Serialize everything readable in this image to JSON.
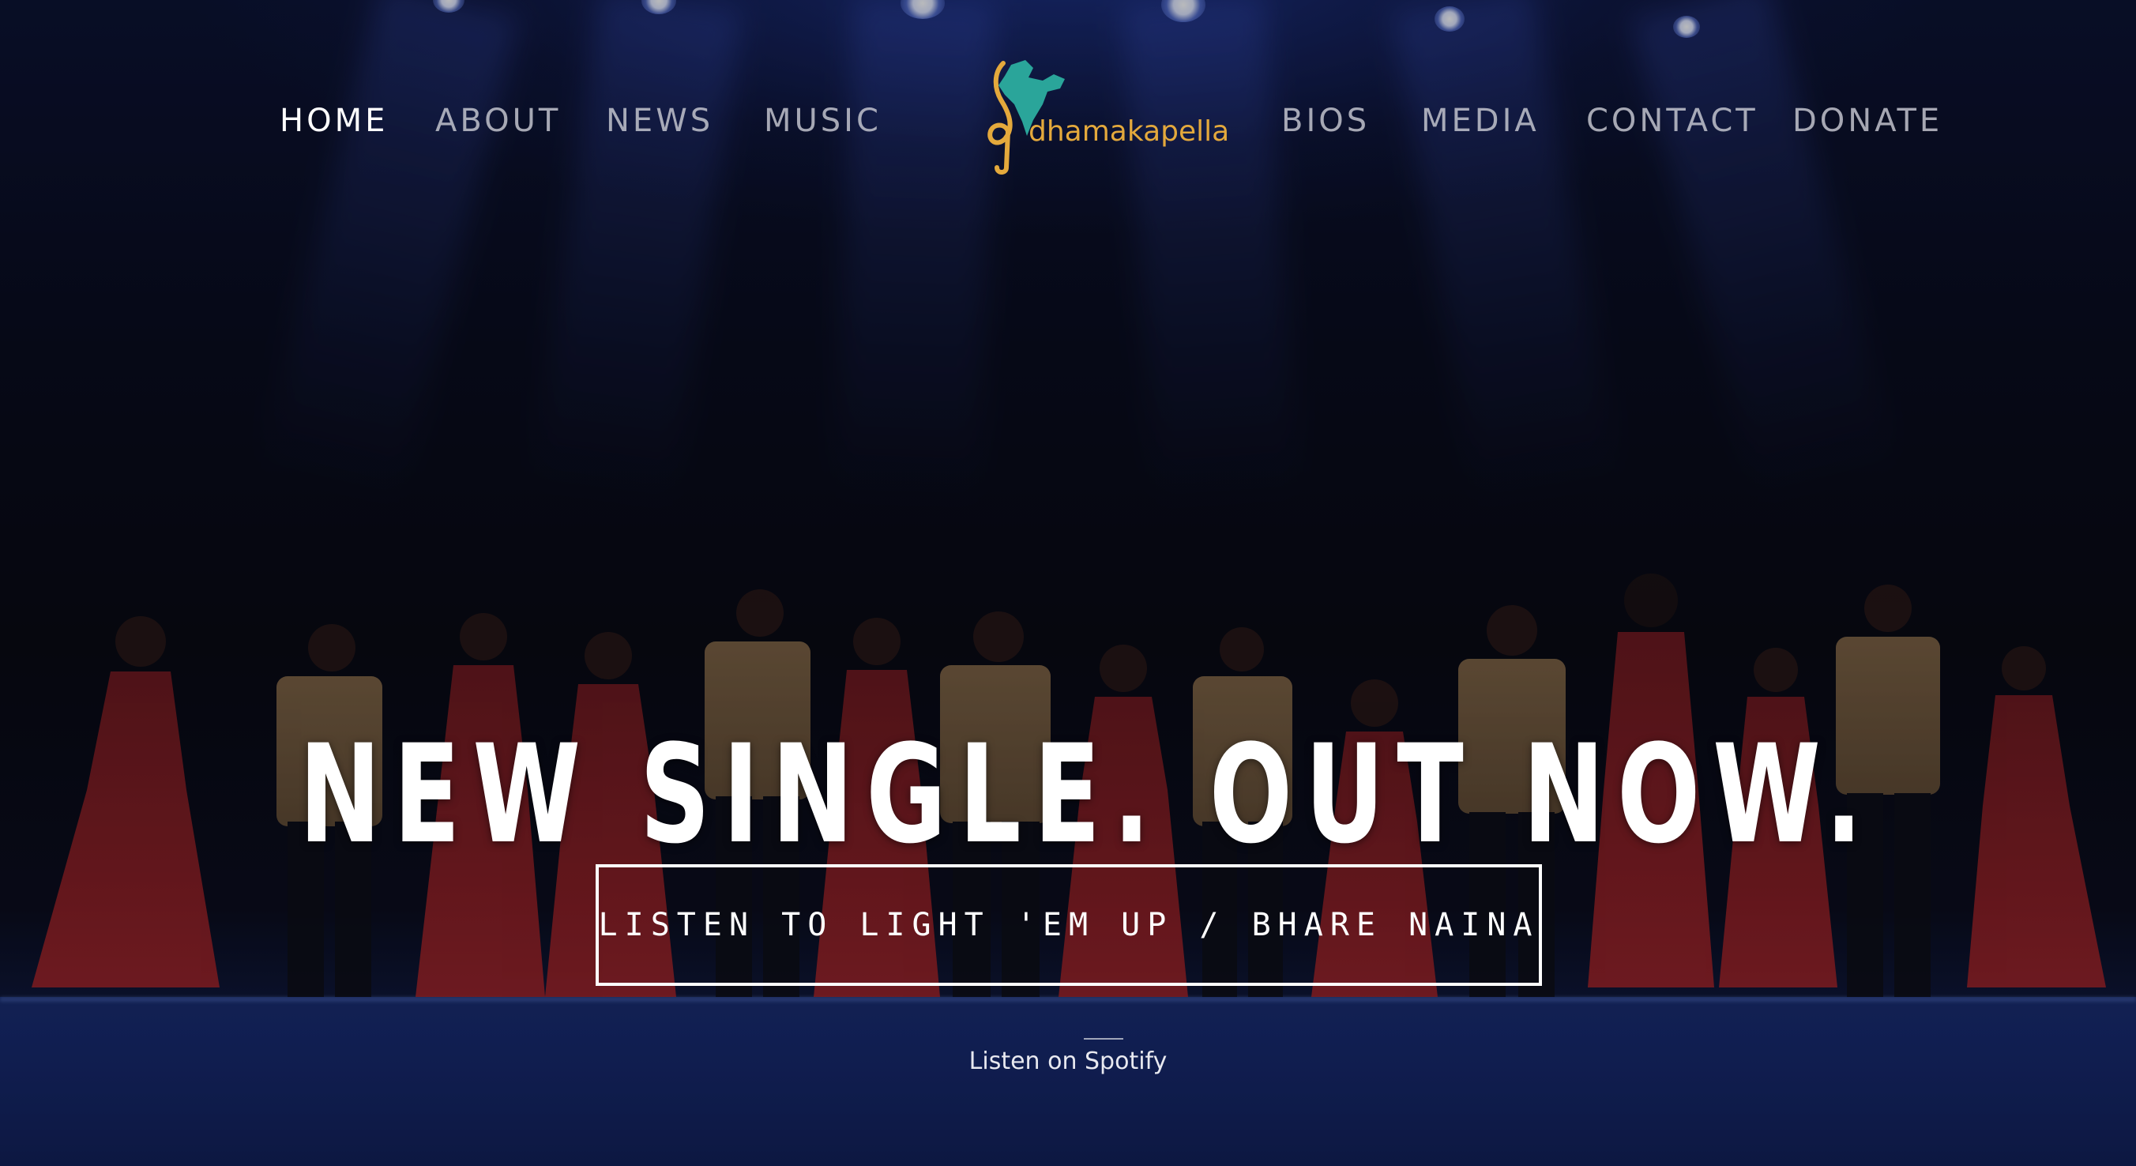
{
  "nav": {
    "left": [
      {
        "label": "HOME",
        "active": true
      },
      {
        "label": "ABOUT",
        "active": false
      },
      {
        "label": "NEWS",
        "active": false
      },
      {
        "label": "MUSIC",
        "active": false
      }
    ],
    "right": [
      {
        "label": "BIOS",
        "active": false
      },
      {
        "label": "MEDIA",
        "active": false
      },
      {
        "label": "CONTACT",
        "active": false
      },
      {
        "label": "DONATE",
        "active": false
      }
    ]
  },
  "logo": {
    "text": "dhamakapella",
    "icons": [
      "treble-clef-icon",
      "india-map-icon"
    ],
    "color": "#e4a93c",
    "map_color": "#2aa59a"
  },
  "hero": {
    "headline": "NEW SINGLE. OUT NOW.",
    "cta_label": "LISTEN TO LIGHT 'EM UP / BHARE NAINA",
    "secondary_link": "Listen on Spotify"
  },
  "colors": {
    "text_primary": "#ffffff",
    "nav_inactive": "#c9cad3",
    "stage_blue": "#16265e",
    "costume_red": "#9b1f22",
    "costume_gold": "#b08a5a"
  }
}
